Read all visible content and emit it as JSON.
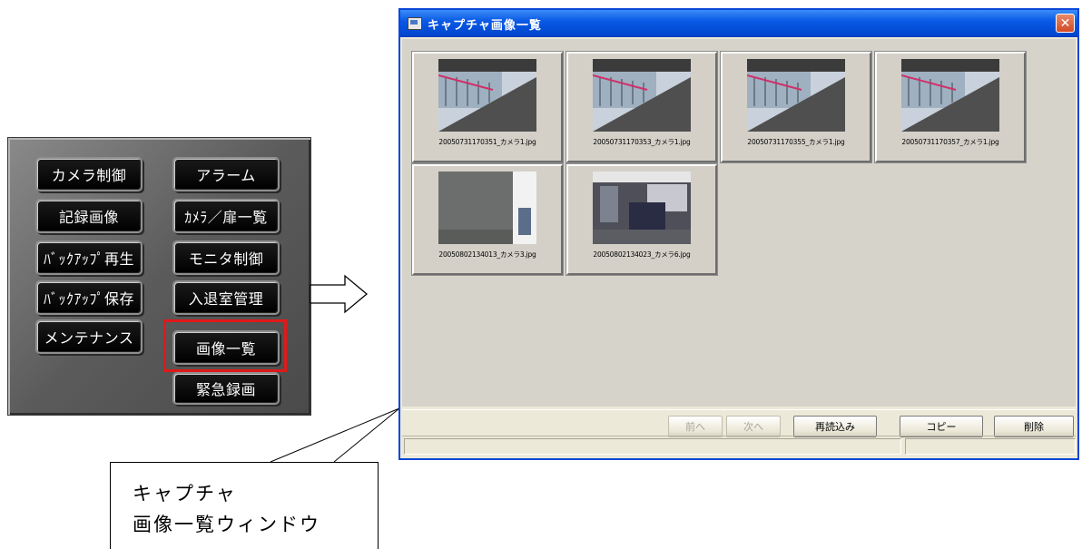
{
  "panel": {
    "buttons": [
      {
        "label": "カメラ制御"
      },
      {
        "label": "アラーム"
      },
      {
        "label": "記録画像"
      },
      {
        "label": "ｶﾒﾗ／扉一覧"
      },
      {
        "label": "ﾊﾞｯｸｱｯﾌﾟ再生"
      },
      {
        "label": "モニタ制御"
      },
      {
        "label": "ﾊﾞｯｸｱｯﾌﾟ保存"
      },
      {
        "label": "入退室管理"
      },
      {
        "label": "メンテナンス"
      },
      {
        "label": "画像一覧"
      },
      {
        "label": "緊急録画"
      }
    ],
    "highlight_color": "#e01919"
  },
  "window": {
    "title": "キャプチャ画像一覧",
    "close_icon": "close-icon",
    "thumbnails": [
      {
        "filename": "20050731170351_カメラ1.jpg"
      },
      {
        "filename": "20050731170353_カメラ1.jpg"
      },
      {
        "filename": "20050731170355_カメラ1.jpg"
      },
      {
        "filename": "20050731170357_カメラ1.jpg"
      },
      {
        "filename": "20050802134013_カメラ3.jpg"
      },
      {
        "filename": "20050802134023_カメラ6.jpg"
      }
    ],
    "buttons": {
      "prev": "前へ",
      "next": "次へ",
      "reload": "再読込み",
      "copy": "コピー",
      "delete": "削除"
    }
  },
  "callout": {
    "line1": "キャプチャ",
    "line2": "画像一覧ウィンドウ"
  },
  "colors": {
    "titlebar": "#0a5ae6",
    "window_bg": "#ece9d8",
    "panel_button_bg": "#000000"
  }
}
